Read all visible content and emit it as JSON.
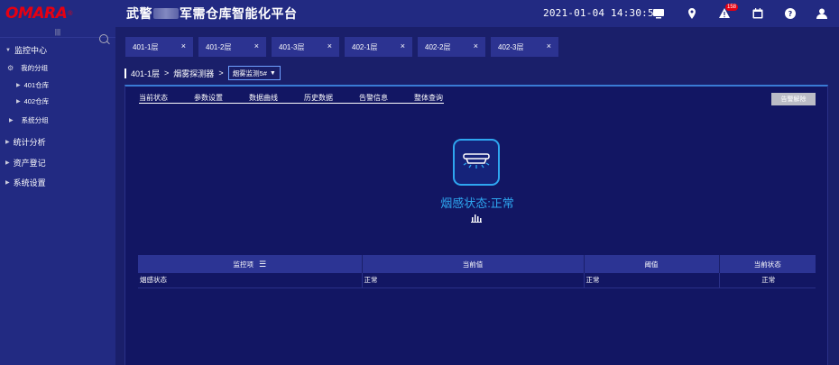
{
  "header": {
    "logo": "OMARA",
    "title_part1": "武警",
    "title_part2": "军需仓库智能化平台",
    "datetime": "2021-01-04 14:30:59",
    "alert_count": "158"
  },
  "sidebar": {
    "toggle": "|||",
    "monitor_center": "监控中心",
    "my_group": "我的分组",
    "warehouse_401": "401仓库",
    "warehouse_402": "402仓库",
    "system_group": "系统分组",
    "stats": "统计分析",
    "assets": "资产登记",
    "settings": "系统设置"
  },
  "tabs": [
    "401-1层",
    "401-2层",
    "401-3层",
    "402-1层",
    "402-2层",
    "402-3层"
  ],
  "breadcrumb": {
    "level1": "401-1层",
    "sep": ">",
    "level2": "烟雾探测器",
    "selected": "烟雾监测5#"
  },
  "subtabs": [
    "当前状态",
    "参数设置",
    "数据曲线",
    "历史数据",
    "告警信息",
    "整体查询"
  ],
  "alarm_button": "告警解除",
  "status_text": "烟感状态:正常",
  "table": {
    "headers": [
      "监控项",
      "当前值",
      "阈值",
      "当前状态"
    ],
    "row": [
      "烟感状态",
      "正常",
      "正常",
      "正常"
    ]
  }
}
